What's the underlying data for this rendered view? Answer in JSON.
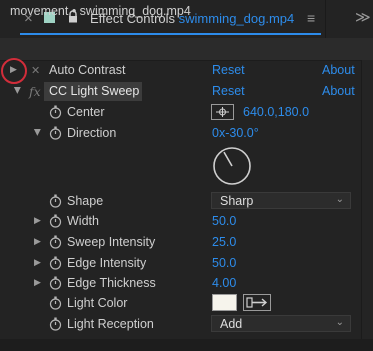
{
  "panel": {
    "tab_label": "Effect Controls",
    "tab_clip": "swimming_dog.mp4",
    "tab_menu_glyph": "≡",
    "overflow_glyph": "≫",
    "breadcrumb": "movement • swimming_dog.mp4"
  },
  "effects": [
    {
      "name": "Auto Contrast",
      "reset_label": "Reset",
      "about_label": "About"
    },
    {
      "name": "CC Light Sweep",
      "reset_label": "Reset",
      "about_label": "About"
    }
  ],
  "properties": {
    "center": {
      "label": "Center",
      "value": "640.0,180.0"
    },
    "direction": {
      "label": "Direction",
      "value": "0x-30.0°",
      "angle_deg": -30
    },
    "shape": {
      "label": "Shape",
      "value": "Sharp"
    },
    "width": {
      "label": "Width",
      "value": "50.0"
    },
    "sweep_intensity": {
      "label": "Sweep Intensity",
      "value": "25.0"
    },
    "edge_intensity": {
      "label": "Edge Intensity",
      "value": "50.0"
    },
    "edge_thickness": {
      "label": "Edge Thickness",
      "value": "4.00"
    },
    "light_color": {
      "label": "Light Color",
      "color": "#f6f4ec"
    },
    "light_reception": {
      "label": "Light Reception",
      "value": "Add"
    }
  },
  "colors": {
    "accent": "#2d8ceb",
    "highlight_ring": "#d22d3a",
    "panel_bg": "#232323"
  }
}
